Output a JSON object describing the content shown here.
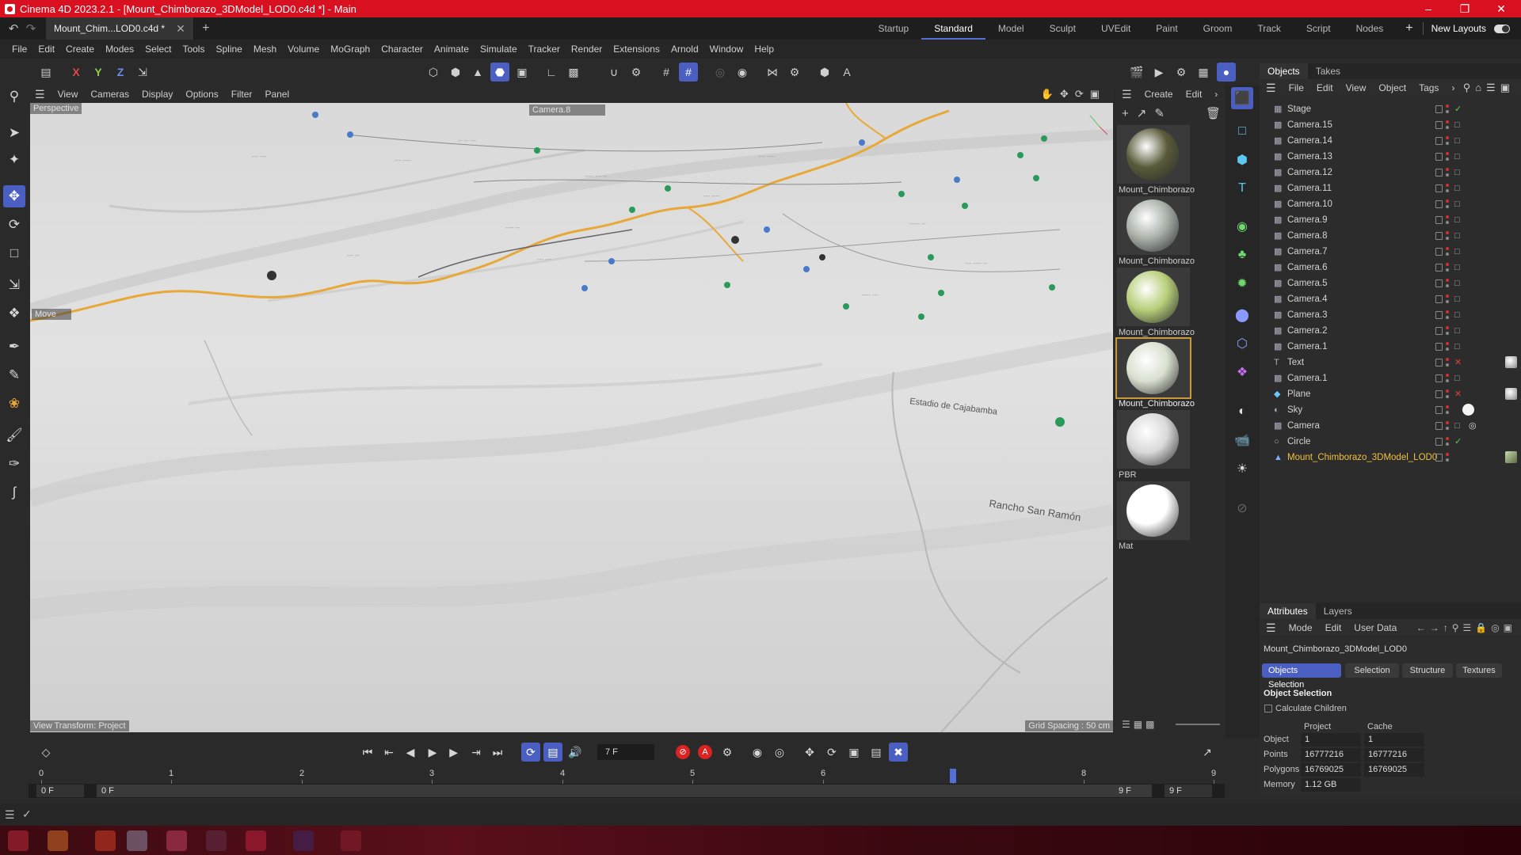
{
  "window": {
    "title": "Cinema 4D 2023.2.1 - [Mount_Chimborazo_3DModel_LOD0.c4d *] - Main"
  },
  "document_tab": {
    "label": "Mount_Chim...LOD0.c4d *"
  },
  "layouts": [
    "Startup",
    "Standard",
    "Model",
    "Sculpt",
    "UVEdit",
    "Paint",
    "Groom",
    "Track",
    "Script",
    "Nodes"
  ],
  "new_layouts": "New Layouts",
  "menus": [
    "File",
    "Edit",
    "Create",
    "Modes",
    "Select",
    "Tools",
    "Spline",
    "Mesh",
    "Volume",
    "MoGraph",
    "Character",
    "Animate",
    "Simulate",
    "Tracker",
    "Render",
    "Extensions",
    "Arnold",
    "Window",
    "Help"
  ],
  "axis": {
    "x": "X",
    "y": "Y",
    "z": "Z"
  },
  "viewport": {
    "menus": [
      "View",
      "Cameras",
      "Display",
      "Options",
      "Filter",
      "Panel"
    ],
    "mode": "Perspective",
    "camera": "Camera.8",
    "hud_move": "Move",
    "view_transform": "View Transform: Project",
    "grid_spacing": "Grid Spacing : 50 cm",
    "map_labels": [
      "Estadio de Cajabamba",
      "Rancho San Ramón"
    ]
  },
  "materials": {
    "menus": [
      "Create",
      "Edit"
    ],
    "items": [
      {
        "name": "Mount_Chimborazo",
        "color": "#5a5a3a"
      },
      {
        "name": "Mount_Chimborazo",
        "color": "#a8b0a8"
      },
      {
        "name": "Mount_Chimborazo",
        "color": "#b8cf7a"
      },
      {
        "name": "Mount_Chimborazo",
        "color": "#d8e0d0",
        "selected": true
      },
      {
        "name": "PBR",
        "color": "#d9d9d9"
      },
      {
        "name": "Mat",
        "color": "#ffffff"
      }
    ]
  },
  "objects_panel": {
    "tabs": [
      "Objects",
      "Takes"
    ],
    "menus": [
      "File",
      "Edit",
      "View",
      "Object",
      "Tags"
    ],
    "items": [
      {
        "name": "Stage",
        "icon": "stage-icon"
      },
      {
        "name": "Camera.15",
        "icon": "camera-icon"
      },
      {
        "name": "Camera.14",
        "icon": "camera-icon"
      },
      {
        "name": "Camera.13",
        "icon": "camera-icon"
      },
      {
        "name": "Camera.12",
        "icon": "camera-icon"
      },
      {
        "name": "Camera.11",
        "icon": "camera-icon"
      },
      {
        "name": "Camera.10",
        "icon": "camera-icon"
      },
      {
        "name": "Camera.9",
        "icon": "camera-icon"
      },
      {
        "name": "Camera.8",
        "icon": "camera-icon"
      },
      {
        "name": "Camera.7",
        "icon": "camera-icon"
      },
      {
        "name": "Camera.6",
        "icon": "camera-icon"
      },
      {
        "name": "Camera.5",
        "icon": "camera-icon"
      },
      {
        "name": "Camera.4",
        "icon": "camera-icon"
      },
      {
        "name": "Camera.3",
        "icon": "camera-icon"
      },
      {
        "name": "Camera.2",
        "icon": "camera-icon"
      },
      {
        "name": "Camera.1",
        "icon": "camera-icon"
      },
      {
        "name": "Text",
        "icon": "text-icon"
      },
      {
        "name": "Camera.1",
        "icon": "camera-icon"
      },
      {
        "name": "Plane",
        "icon": "plane-icon"
      },
      {
        "name": "Sky",
        "icon": "sky-icon"
      },
      {
        "name": "Camera",
        "icon": "camera-icon"
      },
      {
        "name": "Circle",
        "icon": "circle-icon"
      },
      {
        "name": "Mount_Chimborazo_3DModel_LOD0",
        "icon": "polygon-object-icon",
        "selected": true
      }
    ]
  },
  "attributes": {
    "tabs": [
      "Attributes",
      "Layers"
    ],
    "menus": [
      "Mode",
      "Edit",
      "User Data"
    ],
    "object_name": "Mount_Chimborazo_3DModel_LOD0",
    "subtabs": [
      "Objects Selection",
      "Selection",
      "Structure",
      "Textures"
    ],
    "section": "Object Selection",
    "calc_children": "Calculate Children",
    "col_project": "Project",
    "col_cache": "Cache",
    "rows": [
      {
        "label": "Object",
        "project": "1",
        "cache": "1"
      },
      {
        "label": "Points",
        "project": "16777216",
        "cache": "16777216"
      },
      {
        "label": "Polygons",
        "project": "16769025",
        "cache": "16769025"
      },
      {
        "label": "Memory",
        "project": "1.12 GB",
        "cache": ""
      }
    ]
  },
  "timeline": {
    "current_frame": "7 F",
    "current_frame_value": 7,
    "ticks": [
      "0",
      "1",
      "2",
      "3",
      "4",
      "5",
      "6",
      "7",
      "8",
      "9"
    ],
    "start": "0 F",
    "range_start": "0 F",
    "range_end": "9 F",
    "end": "9 F",
    "autokey_letter": "A"
  },
  "colors": {
    "accent": "#4a5fc1",
    "titlebar": "#d8101f",
    "selection": "#f0c040",
    "road": "#e8a838",
    "marker": "#2a9a5a"
  }
}
